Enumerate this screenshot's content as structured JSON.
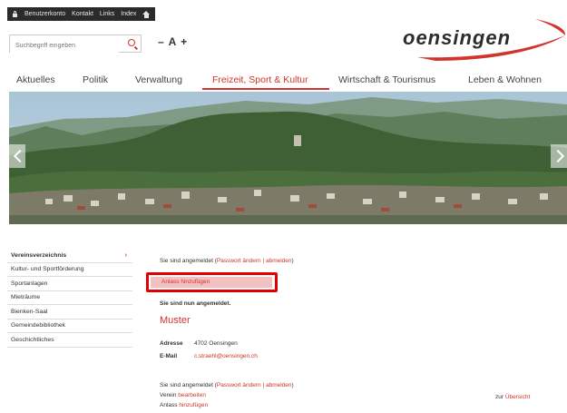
{
  "topbar": {
    "account": "Benutzerkonto",
    "contact": "Kontakt",
    "links": "Links",
    "index": "Index"
  },
  "search": {
    "placeholder": "Suchbegriff eingeben"
  },
  "font_size_control": "– A +",
  "logo": {
    "text": "oensingen",
    "accent_color": "#d0342c"
  },
  "nav": {
    "items": [
      "Aktuelles",
      "Politik",
      "Verwaltung",
      "Freizeit, Sport & Kultur",
      "Wirtschaft & Tourismus",
      "Leben & Wohnen"
    ],
    "active": "Freizeit, Sport & Kultur"
  },
  "sidebar": {
    "items": [
      "Vereinsverzeichnis",
      "Kultur- und Sportförderung",
      "Sportanlagen",
      "Mieträume",
      "Bienken-Saal",
      "Gemeindebibliothek",
      "Geschichtliches"
    ],
    "chevron": "›"
  },
  "content": {
    "logged_in_prefix": "Sie sind angemeldet (",
    "change_password": "Passwort ändern",
    "separator": " | ",
    "logout": "abmelden",
    "logged_in_suffix": ")",
    "add_event": "Anlass hinzufügen",
    "now_logged_in": "Sie sind nun angemeldet.",
    "club_name": "Muster",
    "address_label": "Adresse",
    "address_value": "4702 Oensingen",
    "email_label": "E-Mail",
    "email_value": "c.straehl@oensingen.ch",
    "club_label": "Verein",
    "edit": "bearbeiten",
    "event_label": "Anlass",
    "add": "hinzufügen",
    "back_prefix": "zur",
    "overview": "Übersicht"
  },
  "colors": {
    "accent": "#d0342c",
    "topbar": "#2b2b2b",
    "highlight_border": "#e00000"
  }
}
